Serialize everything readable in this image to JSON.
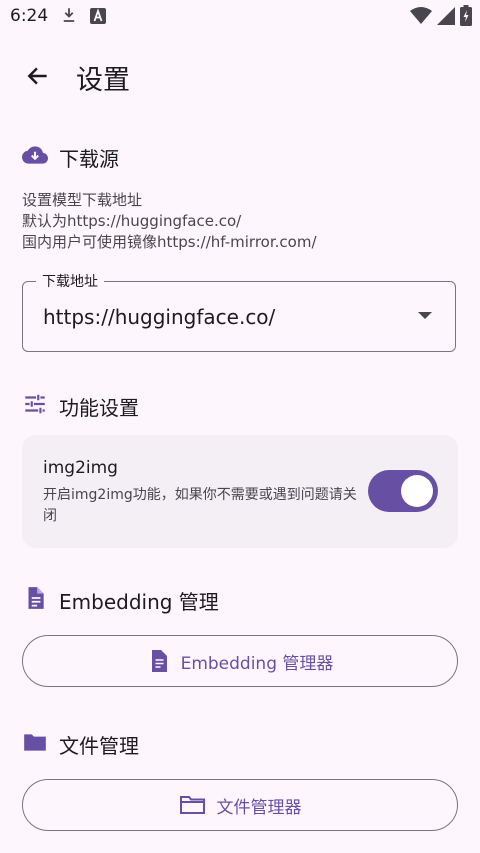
{
  "status_bar": {
    "time": "6:24"
  },
  "header": {
    "title": "设置"
  },
  "download_source": {
    "title": "下载源",
    "description": [
      "设置模型下载地址",
      "默认为https://huggingface.co/",
      "国内用户可使用镜像https://hf-mirror.com/"
    ],
    "field_label": "下载地址",
    "field_value": "https://huggingface.co/"
  },
  "feature_settings": {
    "title": "功能设置",
    "img2img": {
      "title": "img2img",
      "description": "开启img2img功能，如果你不需要或遇到问题请关闭",
      "enabled": true
    }
  },
  "embedding": {
    "title": "Embedding 管理",
    "button_label": "Embedding 管理器"
  },
  "file_management": {
    "title": "文件管理",
    "button_label": "文件管理器"
  },
  "colors": {
    "accent": "#6750a4",
    "background": "#fdf7fd",
    "card": "#f4eff5"
  }
}
